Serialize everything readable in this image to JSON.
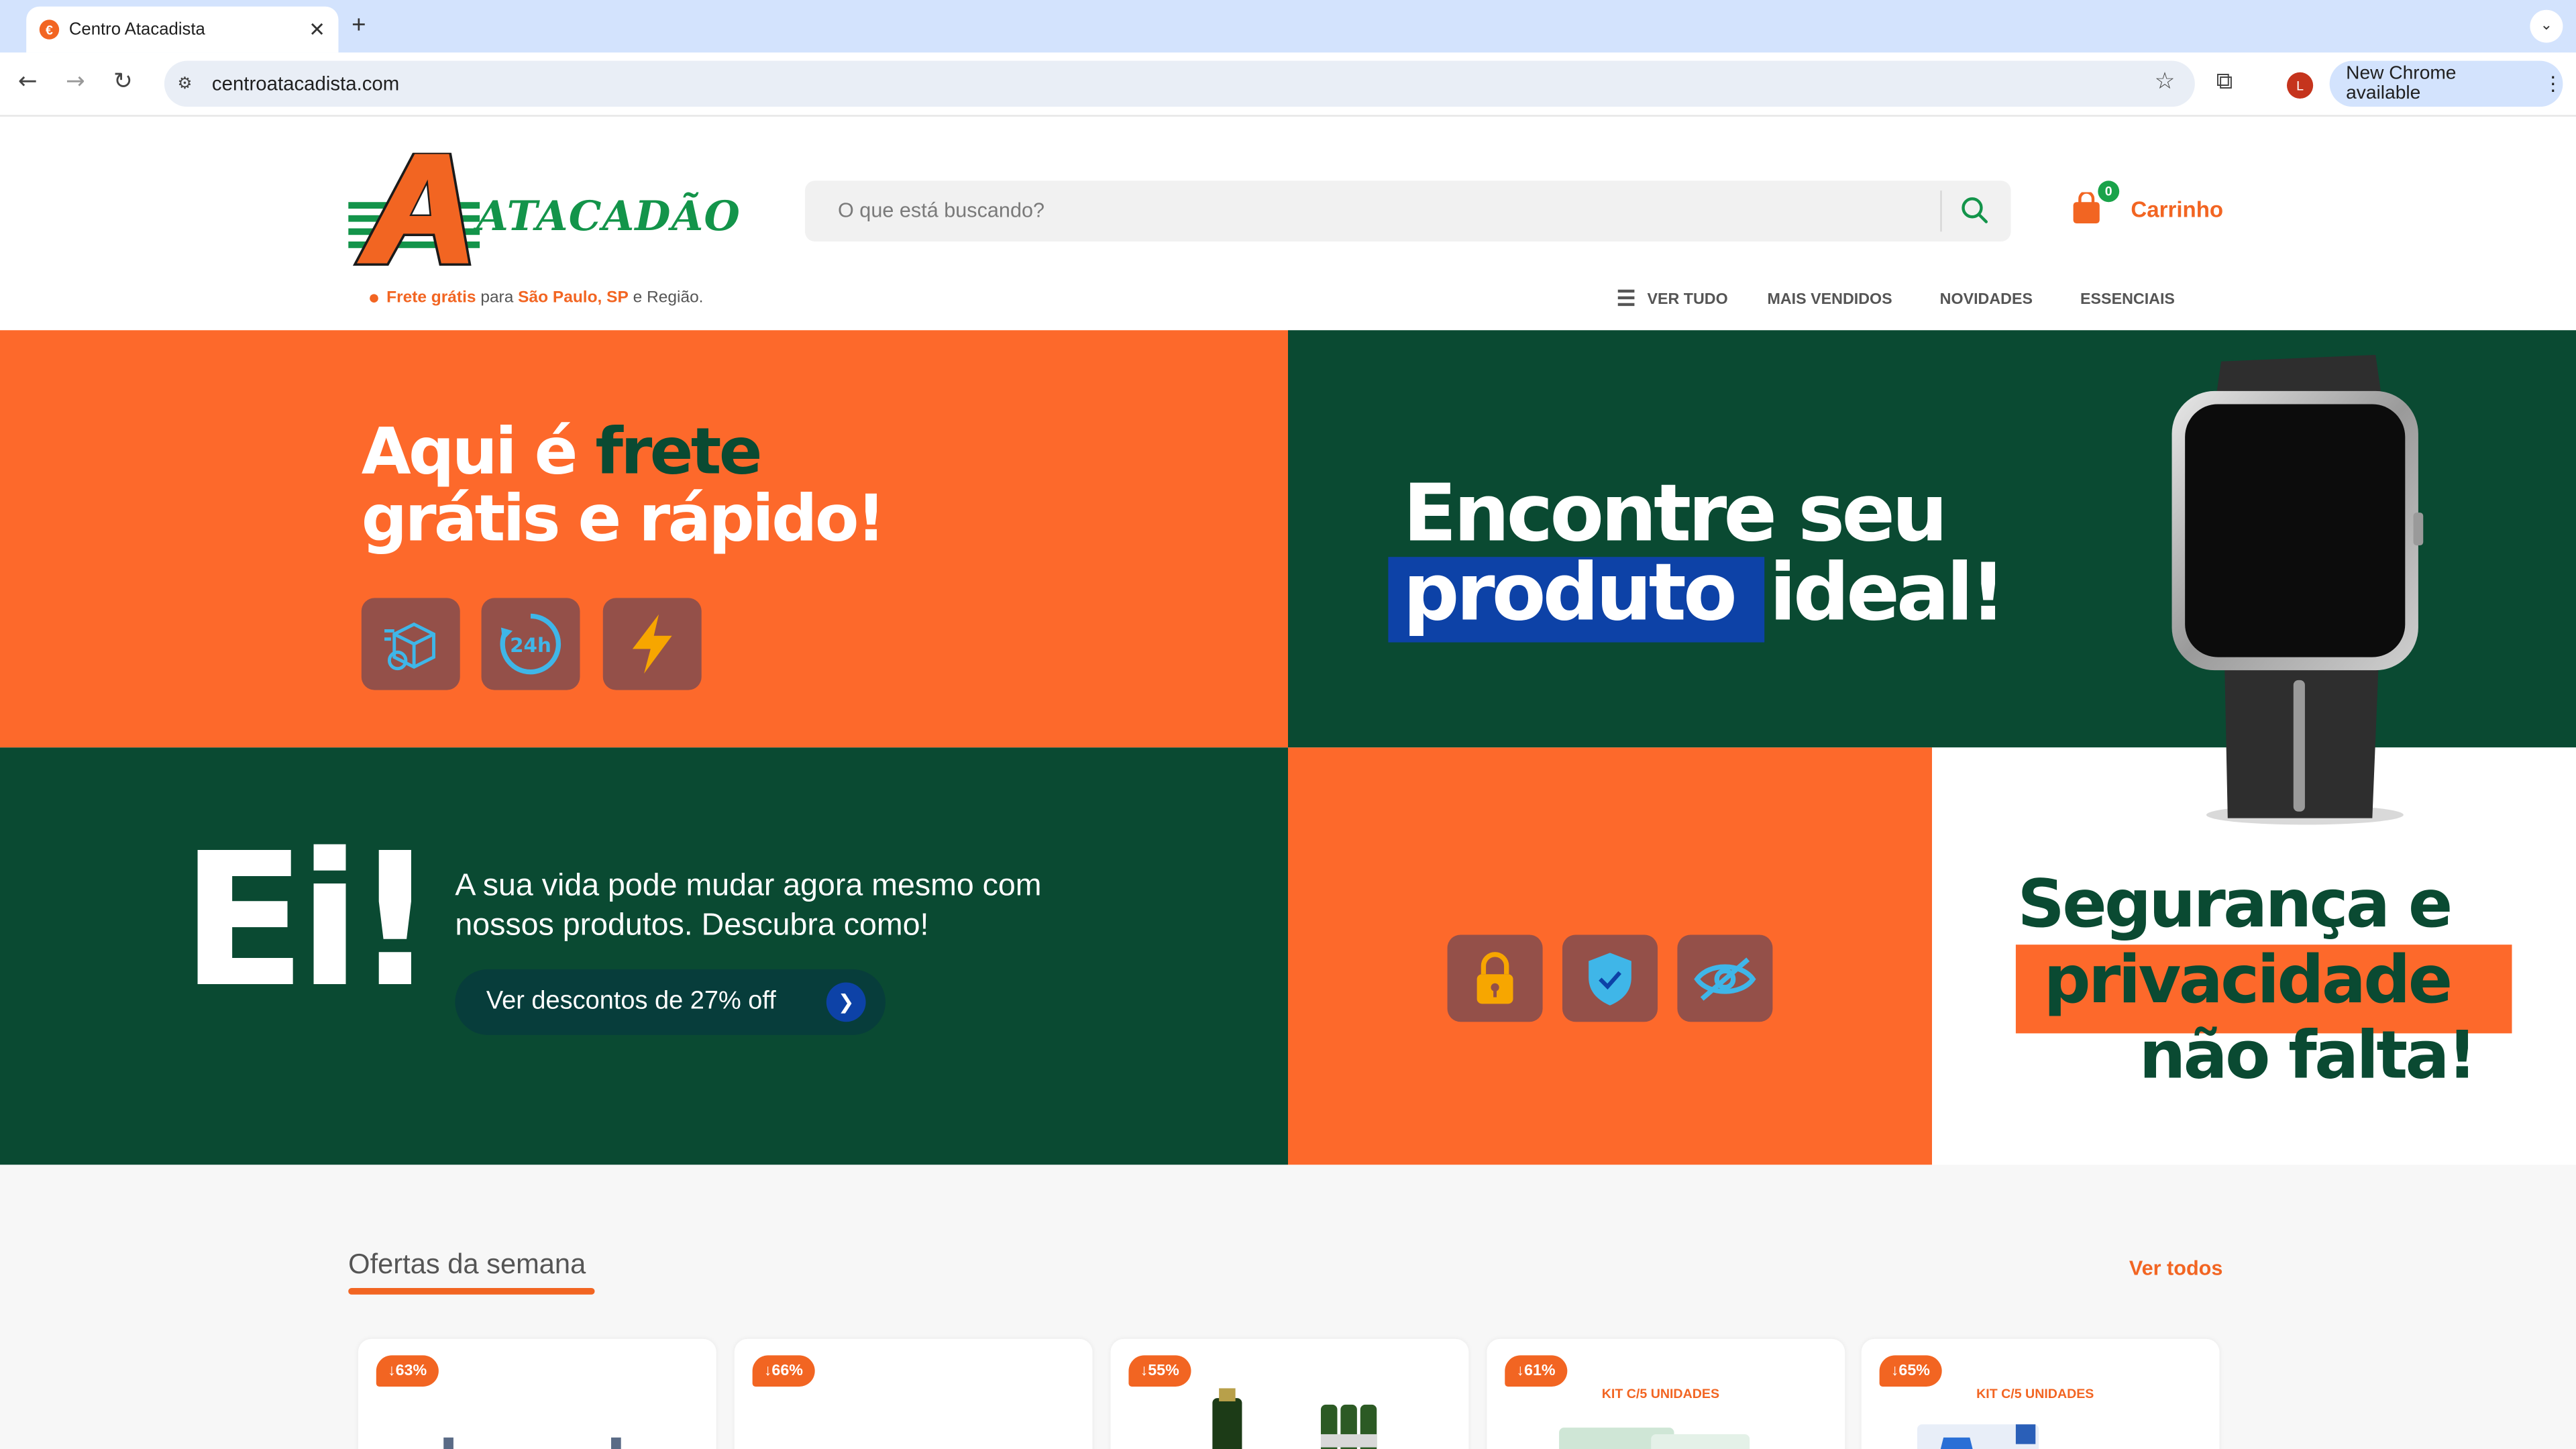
{
  "browser": {
    "tab_title": "Centro Atacadista",
    "tab_favicon": "€",
    "new_tab": "+",
    "url": "centroatacadista.com",
    "profile_initial": "L",
    "update_label": "New Chrome available"
  },
  "header": {
    "logo_text": "ATACADÃO",
    "freight": {
      "part1": "Frete grátis",
      "part2": " para ",
      "part3": "São Paulo, SP",
      "part4": " e Região."
    },
    "search_placeholder": "O que está buscando?",
    "cart_count": "0",
    "cart_label": "Carrinho",
    "nav": [
      "VER TUDO",
      "MAIS VENDIDOS",
      "NOVIDADES",
      "ESSENCIAIS"
    ]
  },
  "banners": {
    "shipping": {
      "line1_white": "Aqui é ",
      "line1_green": "frete",
      "line2": "grátis e rápido!",
      "icons": [
        "box-delivery-icon",
        "24h-clock-icon",
        "lightning-icon"
      ],
      "badge_24": "24h"
    },
    "product": {
      "line1": "Encontre seu",
      "line2_highlight": "produto",
      "line2_rest": "ideal!"
    },
    "promo": {
      "big": "Ei!",
      "text": "A sua vida pode mudar agora mesmo com nossos produtos. Descubra como!",
      "cta": "Ver descontos de 27% off"
    },
    "security_icons": [
      "lock-icon",
      "shield-check-icon",
      "eye-off-icon"
    ],
    "security": {
      "line1": "Segurança e",
      "line2": "privacidade",
      "line3": "não falta!"
    }
  },
  "offers": {
    "title": "Ofertas da semana",
    "see_all": "Ver todos",
    "cards": [
      {
        "discount": "↓63%",
        "kit": ""
      },
      {
        "discount": "↓66%",
        "kit": ""
      },
      {
        "discount": "↓55%",
        "kit": ""
      },
      {
        "discount": "↓61%",
        "kit": "KIT C/5 UNIDADES"
      },
      {
        "discount": "↓65%",
        "kit": "KIT C/5 UNIDADES"
      }
    ]
  },
  "colors": {
    "orange": "#fd692b",
    "dark_green": "#0a4a32",
    "brand_green": "#13944a",
    "blue_highlight": "#0d42a7",
    "icon_tile": "#945049"
  }
}
